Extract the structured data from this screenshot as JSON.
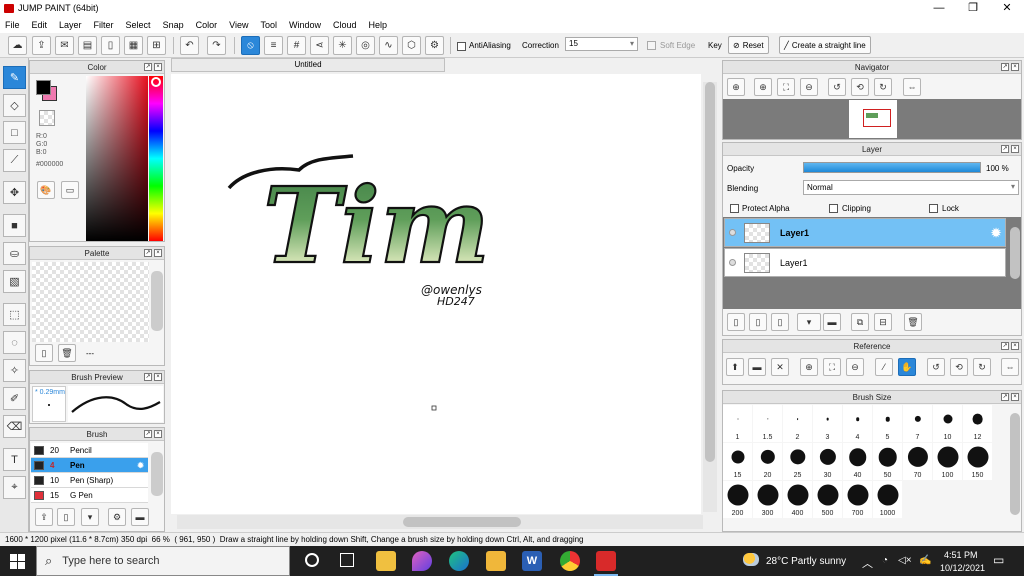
{
  "window": {
    "title": "JUMP PAINT (64bit)",
    "controls": [
      "—",
      "❐",
      "✕"
    ]
  },
  "menu": [
    "File",
    "Edit",
    "Layer",
    "Filter",
    "Select",
    "Snap",
    "Color",
    "View",
    "Tool",
    "Window",
    "Cloud",
    "Help"
  ],
  "toolbar": {
    "antialiasing_label": "AntiAliasing",
    "correction_label": "Correction",
    "correction_value": "15",
    "soft_edge_label": "Soft Edge",
    "key_label": "Key",
    "reset_label": "Reset",
    "straight_line_label": "Create a straight line"
  },
  "color_panel": {
    "title": "Color",
    "r": "R:0",
    "g": "G:0",
    "b": "B:0",
    "hex": "#000000",
    "main_color": "#000000",
    "sub_color": "#f07ab0"
  },
  "palette_panel": {
    "title": "Palette",
    "dash": "---"
  },
  "brush_preview_panel": {
    "title": "Brush Preview",
    "size": "* 0.29mm"
  },
  "brush_panel": {
    "title": "Brush",
    "items": [
      {
        "size": "20",
        "name": "Pencil",
        "color": "#222222"
      },
      {
        "size": "4",
        "name": "Pen",
        "color": "#222222"
      },
      {
        "size": "10",
        "name": "Pen (Sharp)",
        "color": "#222222"
      },
      {
        "size": "15",
        "name": "G Pen",
        "color": "#e0303a"
      }
    ]
  },
  "document": {
    "tab": "Untitled",
    "art_text": "Tim",
    "signature_line1": "@owenlys",
    "signature_line2": "HD247"
  },
  "navigator_panel": {
    "title": "Navigator"
  },
  "layer_panel": {
    "title": "Layer",
    "opacity_label": "Opacity",
    "opacity_value": "100 %",
    "opacity_fraction": 1.0,
    "blending_label": "Blending",
    "blending_value": "Normal",
    "protect_alpha": "Protect Alpha",
    "clipping": "Clipping",
    "lock": "Lock",
    "layers": [
      "Layer1",
      "Layer1"
    ]
  },
  "reference_panel": {
    "title": "Reference"
  },
  "brush_size_panel": {
    "title": "Brush Size",
    "sizes": [
      "1",
      "1.5",
      "2",
      "3",
      "4",
      "5",
      "7",
      "10",
      "12",
      "15",
      "20",
      "25",
      "30",
      "40",
      "50",
      "70",
      "100",
      "150",
      "200",
      "300",
      "400",
      "500",
      "700",
      "1000"
    ]
  },
  "status": {
    "dimensions": "1600 * 1200 pixel",
    "physical": "(11.6 * 8.7cm)",
    "dpi": "350 dpi",
    "zoom": "66 %",
    "coords": "( 961, 950 )",
    "hint": "Draw a straight line by holding down Shift, Change a brush size by holding down Ctrl, Alt, and dragging"
  },
  "taskbar": {
    "search_placeholder": "Type here to search",
    "weather": "28°C  Partly sunny",
    "time": "4:51 PM",
    "date": "10/12/2021"
  }
}
